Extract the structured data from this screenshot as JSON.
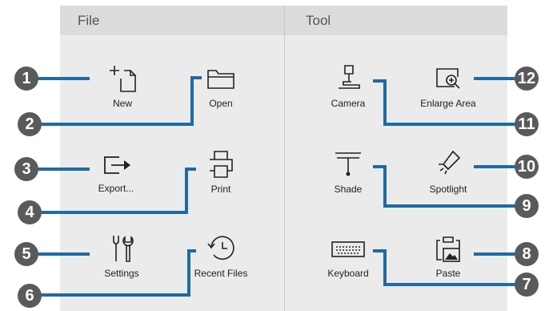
{
  "sections": {
    "file": {
      "title": "File"
    },
    "tool": {
      "title": "Tool"
    }
  },
  "file_items": {
    "new": {
      "label": "New",
      "icon": "new-file-icon"
    },
    "open": {
      "label": "Open",
      "icon": "folder-icon"
    },
    "export": {
      "label": "Export...",
      "icon": "export-icon"
    },
    "print": {
      "label": "Print",
      "icon": "printer-icon"
    },
    "settings": {
      "label": "Settings",
      "icon": "settings-icon"
    },
    "recent": {
      "label": "Recent Files",
      "icon": "clock-icon"
    }
  },
  "tool_items": {
    "camera": {
      "label": "Camera",
      "icon": "camera-icon"
    },
    "enlarge": {
      "label": "Enlarge Area",
      "icon": "zoom-in-icon"
    },
    "shade": {
      "label": "Shade",
      "icon": "shade-icon"
    },
    "spotlight": {
      "label": "Spotlight",
      "icon": "spotlight-icon"
    },
    "keyboard": {
      "label": "Keyboard",
      "icon": "keyboard-icon"
    },
    "paste": {
      "label": "Paste",
      "icon": "paste-icon"
    }
  },
  "callouts": [
    "1",
    "2",
    "3",
    "4",
    "5",
    "6",
    "7",
    "8",
    "9",
    "10",
    "11",
    "12"
  ],
  "colors": {
    "callout_line": "#1f6aa5",
    "callout_badge": "#5a5a5a",
    "panel": "#ebebeb",
    "header": "#dcdcdc"
  }
}
